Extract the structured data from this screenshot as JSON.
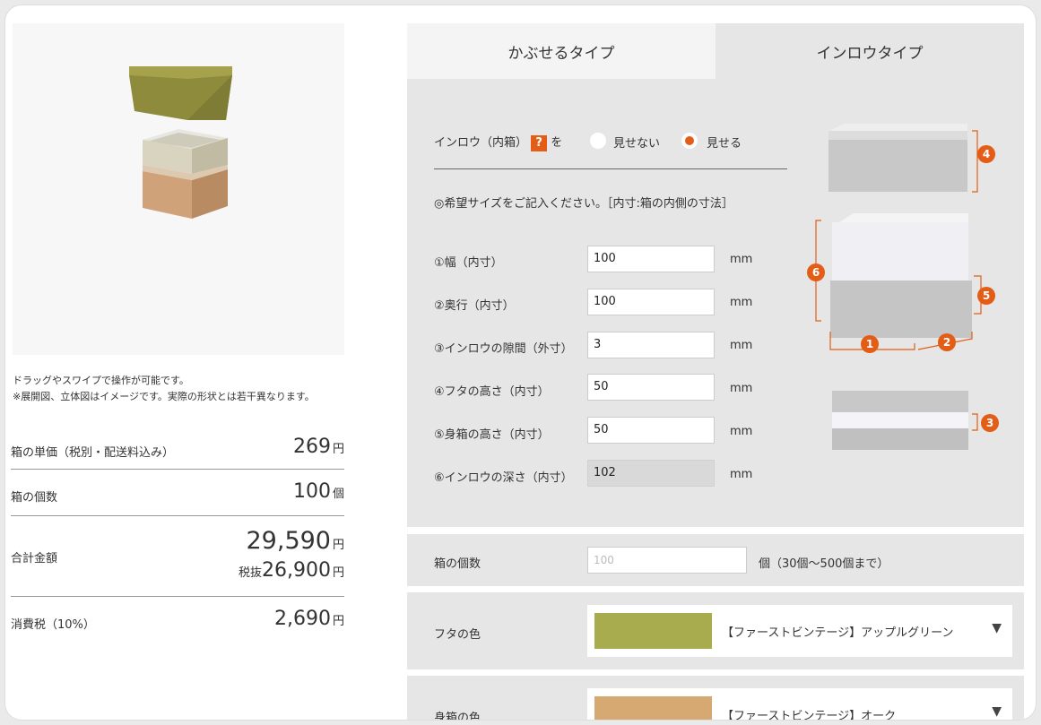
{
  "preview": {
    "note_line1": "ドラッグやスワイプで操作が可能です。",
    "note_line2": "※展開図、立体図はイメージです。実際の形状とは若干異なります。"
  },
  "pricing": {
    "unit_price_label": "箱の単価（税別・配送料込み）",
    "unit_price_value": "269",
    "unit_price_unit": "円",
    "count_label": "箱の個数",
    "count_value": "100",
    "count_unit": "個",
    "total_label": "合計金額",
    "total_value": "29,590",
    "total_unit": "円",
    "total_ex_prefix": "税抜",
    "total_ex_value": "26,900",
    "total_ex_unit": "円",
    "tax_label": "消費税（10%）",
    "tax_value": "2,690",
    "tax_unit": "円"
  },
  "tabs": [
    "かぶせるタイプ",
    "インロウタイプ"
  ],
  "inner_box": {
    "label": "インロウ（内箱）",
    "help": "?",
    "suffix": "を",
    "option_hide": "見せない",
    "option_show": "見せる",
    "selected": "見せる"
  },
  "size_note": "◎希望サイズをご記入ください。［内寸:箱の内側の寸法］",
  "dimensions": [
    {
      "label": "①幅（内寸）",
      "value": "100",
      "unit": "mm"
    },
    {
      "label": "②奥行（内寸）",
      "value": "100",
      "unit": "mm"
    },
    {
      "label": "③インロウの隙間（外寸）",
      "value": "3",
      "unit": "mm"
    },
    {
      "label": "④フタの高さ（内寸）",
      "value": "50",
      "unit": "mm"
    },
    {
      "label": "⑤身箱の高さ（内寸）",
      "value": "50",
      "unit": "mm"
    },
    {
      "label": "⑥インロウの深さ（内寸）",
      "value": "102",
      "unit": "mm"
    }
  ],
  "diagram_badges": [
    "4",
    "6",
    "5",
    "1",
    "2",
    "3"
  ],
  "quantity": {
    "label": "箱の個数",
    "placeholder": "100",
    "hint": "個（30個〜500個まで）"
  },
  "lid_color": {
    "label": "フタの色",
    "value": "【ファーストビンテージ】アップルグリーン",
    "swatch": "#a8ac4f"
  },
  "body_color": {
    "label": "身箱の色",
    "value": "【ファーストビンテージ】オーク",
    "swatch": "#d6a872"
  },
  "colors": {
    "accent": "#e35d16"
  }
}
